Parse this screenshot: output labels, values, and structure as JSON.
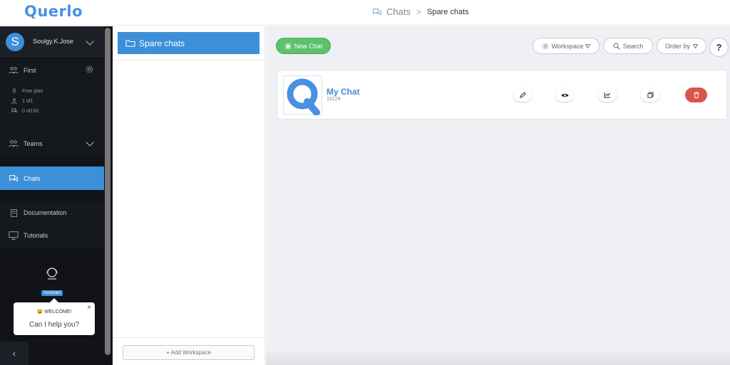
{
  "app": {
    "logo": "Querlo"
  },
  "breadcrumb": {
    "root": "Chats",
    "separator": ">",
    "current": "Spare chats"
  },
  "sidebar": {
    "user": {
      "initial": "S",
      "name": "Soulgy.K.Jose"
    },
    "workspace": {
      "label": "First"
    },
    "plan": {
      "name": "Free plan",
      "users": "1 of1",
      "chats": "0 of150"
    },
    "items": [
      {
        "label": "Teams",
        "icon": "team-icon"
      },
      {
        "label": "Chats",
        "icon": "chat-icon",
        "active": true
      },
      {
        "label": "Documentation",
        "icon": "book-icon"
      },
      {
        "label": "Tutorials",
        "icon": "monitor-icon"
      }
    ],
    "assistant": {
      "label": "Assistant"
    },
    "welcome": {
      "title": "😀 WELCOME!",
      "message": "Can I help you?",
      "close": "×"
    },
    "collapse": "‹"
  },
  "workspaces": {
    "items": [
      {
        "label": "Spare chats",
        "icon": "folder-icon"
      }
    ],
    "add_label": "+ Add Workspace"
  },
  "toolbar": {
    "new_chat": "New Chat",
    "workspace": "Workspace",
    "search": "Search",
    "order_by": "Order by",
    "help": "?"
  },
  "chats": [
    {
      "title": "My Chat",
      "id": "15128",
      "actions": [
        "edit-icon",
        "eye-icon",
        "chart-icon",
        "copy-icon",
        "trash-icon"
      ]
    }
  ],
  "colors": {
    "accent": "#3d8fd8",
    "success": "#5cc26b",
    "danger": "#d9534f",
    "sidebar": "#111317"
  }
}
